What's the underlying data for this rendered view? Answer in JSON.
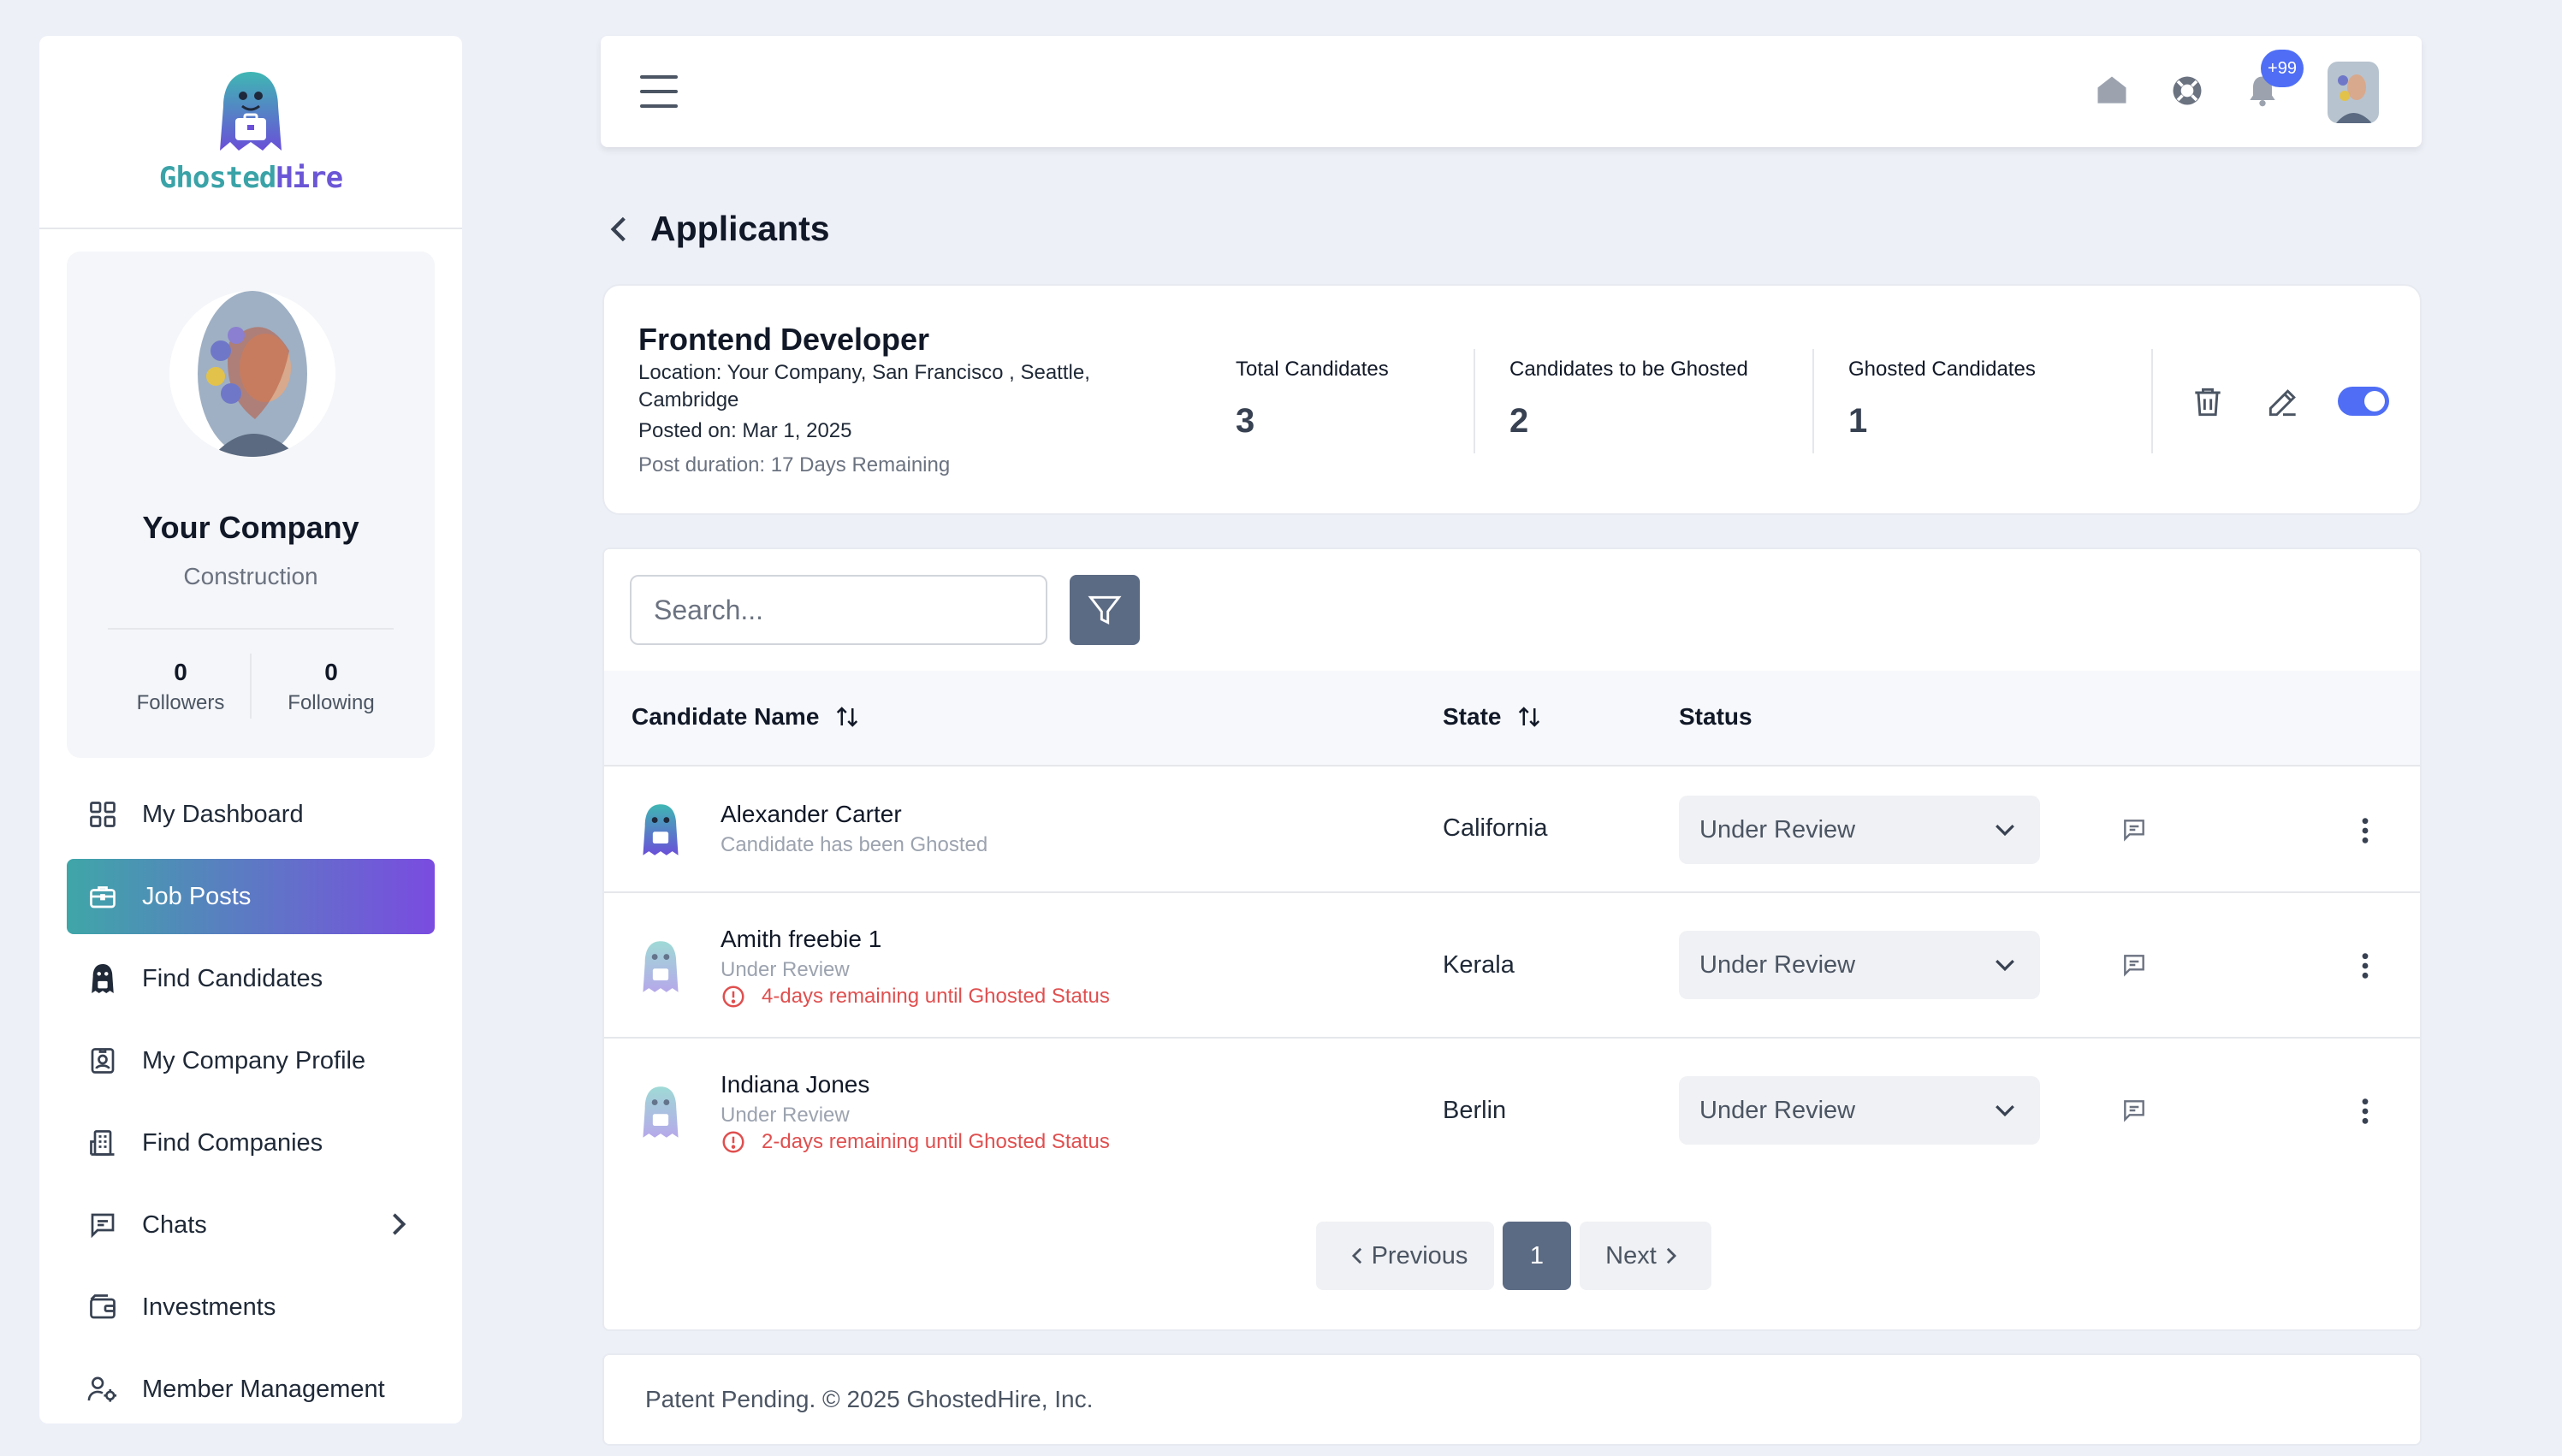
{
  "brand": {
    "name_part1": "Ghosted",
    "name_part2": "Hire"
  },
  "profile": {
    "company_name": "Your Company",
    "industry": "Construction",
    "followers_count": "0",
    "followers_label": "Followers",
    "following_count": "0",
    "following_label": "Following"
  },
  "sidebar": {
    "items": [
      {
        "label": "My Dashboard",
        "icon": "dashboard-grid-icon"
      },
      {
        "label": "Job Posts",
        "icon": "briefcase-icon",
        "active": true
      },
      {
        "label": "Find Candidates",
        "icon": "ghost-icon"
      },
      {
        "label": "My Company Profile",
        "icon": "id-badge-icon"
      },
      {
        "label": "Find Companies",
        "icon": "building-icon"
      },
      {
        "label": "Chats",
        "icon": "chat-icon"
      },
      {
        "label": "Investments",
        "icon": "wallet-icon"
      },
      {
        "label": "Member Management",
        "icon": "user-gear-icon"
      }
    ]
  },
  "header": {
    "notification_badge": "+99"
  },
  "page": {
    "title": "Applicants"
  },
  "job": {
    "title": "Frontend Developer",
    "location": "Location: Your Company, San Francisco , Seattle, Cambridge",
    "posted_on": "Posted on: Mar 1, 2025",
    "duration": "Post duration: 17 Days Remaining",
    "kpis": [
      {
        "label": "Total Candidates",
        "value": "3"
      },
      {
        "label": "Candidates to be Ghosted",
        "value": "2"
      },
      {
        "label": "Ghosted Candidates",
        "value": "1"
      }
    ],
    "active_toggle": true
  },
  "table": {
    "search_placeholder": "Search...",
    "columns": {
      "name": "Candidate Name",
      "state": "State",
      "status": "Status"
    },
    "rows": [
      {
        "name": "Alexander Carter",
        "sub": "Candidate has been Ghosted",
        "warning": "",
        "state": "California",
        "status": "Under Review"
      },
      {
        "name": "Amith freebie 1",
        "sub": "Under Review",
        "warning": "4-days remaining until Ghosted Status",
        "state": "Kerala",
        "status": "Under Review"
      },
      {
        "name": "Indiana Jones",
        "sub": "Under Review",
        "warning": "2-days remaining until Ghosted Status",
        "state": "Berlin",
        "status": "Under Review"
      }
    ],
    "pagination": {
      "previous": "Previous",
      "current": "1",
      "next": "Next"
    }
  },
  "footer": {
    "text": "Patent Pending. © 2025 GhostedHire, Inc."
  },
  "colors": {
    "accent": "#4f6ef5",
    "warning": "#e04f4f",
    "slate_button": "#5c6b84",
    "gradient_start": "#3fa6a8",
    "gradient_end": "#7a4ce0"
  }
}
